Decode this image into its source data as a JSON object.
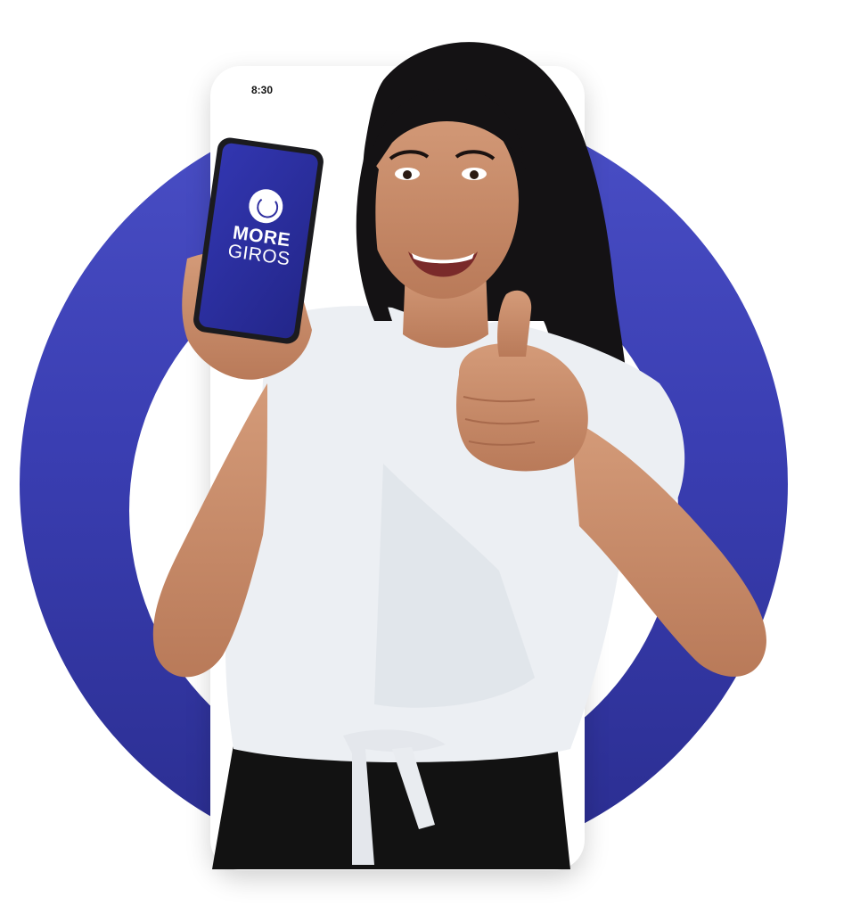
{
  "status_bar": {
    "time": "8:30"
  },
  "brand": {
    "line1": "MORE",
    "line2": "GIROS"
  },
  "colors": {
    "ring_top": "#4a4fc6",
    "ring_bottom": "#2a2d8f",
    "phone_screen": "#2c2e9e",
    "shirt": "#eceff3",
    "pants": "#111111",
    "hair": "#121012",
    "skin": "#c98d6c"
  },
  "image": {
    "subject": "woman-smiling-holding-phone-thumbs-up"
  }
}
